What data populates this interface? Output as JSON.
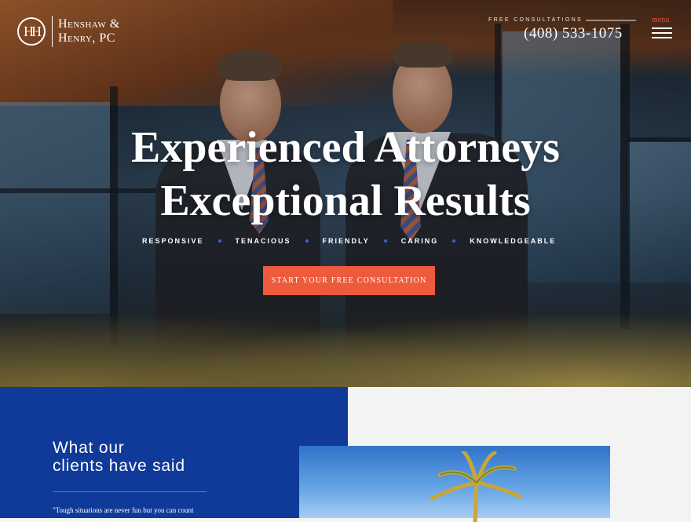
{
  "brand": {
    "logo_monogram": "HH",
    "name_line1": "Henshaw &",
    "name_line2": "Henry, PC"
  },
  "header": {
    "consult_label": "FREE CONSULTATIONS",
    "phone": "(408) 533-1075",
    "menu_label": "menu"
  },
  "hero": {
    "headline_line1": "Experienced Attorneys",
    "headline_line2": "Exceptional Results",
    "values": [
      "RESPONSIVE",
      "TENACIOUS",
      "FRIENDLY",
      "CARING",
      "KNOWLEDGEABLE"
    ],
    "cta_label": "START YOUR FREE CONSULTATION"
  },
  "testimonials": {
    "heading_line1": "What our",
    "heading_line2": "clients have said",
    "quote_snippet": "\"Tough situations are never fun but you can count"
  },
  "colors": {
    "accent": "#ee5a3c",
    "brand_blue": "#0f3a99",
    "value_dot": "#3a63c8"
  }
}
